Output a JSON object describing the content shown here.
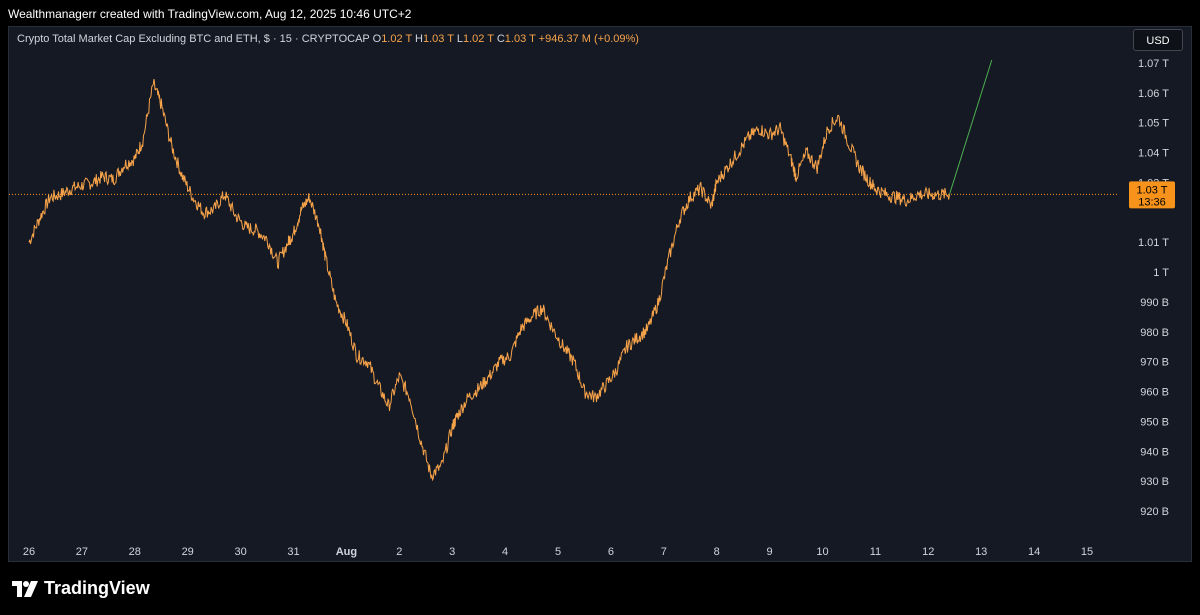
{
  "header": {
    "attribution": "Wealthmanagerr created with TradingView.com, Aug 12, 2025 10:46 UTC+2"
  },
  "legend": {
    "symbol": "Crypto Total Market Cap Excluding BTC and ETH, $ · 15 · CRYPTOCAP",
    "o_label": "O",
    "o_value": "1.02 T",
    "h_label": "H",
    "h_value": "1.03 T",
    "l_label": "L",
    "l_value": "1.02 T",
    "c_label": "C",
    "c_value": "1.03 T",
    "change": "+946.37 M (+0.09%)"
  },
  "currency_button": "USD",
  "price_badge": {
    "price": "1.03 T",
    "countdown": "13:36"
  },
  "footer": {
    "brand": "TradingView"
  },
  "colors": {
    "background": "#151923",
    "series": "#f7a34a",
    "projection": "#4caf50",
    "last_price_line": "#f7931a",
    "badge": "#f7931a"
  },
  "chart_data": {
    "type": "line",
    "title": "Crypto Total Market Cap Excluding BTC and ETH, $ · 15 · CRYPTOCAP",
    "xlabel": "",
    "ylabel": "",
    "y_unit": "USD",
    "ylim": [
      915000000000,
      1075000000000
    ],
    "grid": false,
    "y_ticks": [
      {
        "value": 1070000000000,
        "label": "1.07 T"
      },
      {
        "value": 1060000000000,
        "label": "1.06 T"
      },
      {
        "value": 1050000000000,
        "label": "1.05 T"
      },
      {
        "value": 1040000000000,
        "label": "1.04 T"
      },
      {
        "value": 1030000000000,
        "label": "1.03 T"
      },
      {
        "value": 1010000000000,
        "label": "1.01 T"
      },
      {
        "value": 1000000000000,
        "label": "1 T"
      },
      {
        "value": 990000000000,
        "label": "990 B"
      },
      {
        "value": 980000000000,
        "label": "980 B"
      },
      {
        "value": 970000000000,
        "label": "970 B"
      },
      {
        "value": 960000000000,
        "label": "960 B"
      },
      {
        "value": 950000000000,
        "label": "950 B"
      },
      {
        "value": 940000000000,
        "label": "940 B"
      },
      {
        "value": 930000000000,
        "label": "930 B"
      },
      {
        "value": 920000000000,
        "label": "920 B"
      }
    ],
    "x_ticks": [
      {
        "label": "26",
        "bold": false
      },
      {
        "label": "27",
        "bold": false
      },
      {
        "label": "28",
        "bold": false
      },
      {
        "label": "29",
        "bold": false
      },
      {
        "label": "30",
        "bold": false
      },
      {
        "label": "31",
        "bold": false
      },
      {
        "label": "Aug",
        "bold": true
      },
      {
        "label": "2",
        "bold": false
      },
      {
        "label": "3",
        "bold": false
      },
      {
        "label": "4",
        "bold": false
      },
      {
        "label": "5",
        "bold": false
      },
      {
        "label": "6",
        "bold": false
      },
      {
        "label": "7",
        "bold": false
      },
      {
        "label": "8",
        "bold": false
      },
      {
        "label": "9",
        "bold": false
      },
      {
        "label": "10",
        "bold": false
      },
      {
        "label": "11",
        "bold": false
      },
      {
        "label": "12",
        "bold": false
      },
      {
        "label": "13",
        "bold": false
      },
      {
        "label": "14",
        "bold": false
      },
      {
        "label": "15",
        "bold": false
      }
    ],
    "series": [
      {
        "x_tick_index": [
          0.0,
          0.2,
          0.4,
          0.6,
          0.8,
          1.0,
          1.2,
          1.4,
          1.6,
          1.8,
          2.0,
          2.15,
          2.35,
          2.5,
          2.7,
          2.9,
          3.1,
          3.3,
          3.5,
          3.7,
          3.9,
          4.1,
          4.3,
          4.5,
          4.7,
          4.9,
          5.0,
          5.15,
          5.3,
          5.5,
          5.6,
          5.8,
          6.0,
          6.2,
          6.4,
          6.6,
          6.8,
          7.0,
          7.2,
          7.4,
          7.6,
          7.8,
          8.0,
          8.1,
          8.3,
          8.5,
          8.7,
          8.9,
          9.1,
          9.3,
          9.5,
          9.7,
          9.9,
          10.1,
          10.3,
          10.5,
          10.7,
          10.9,
          11.1,
          11.3,
          11.5,
          11.7,
          11.9,
          12.1,
          12.3,
          12.5,
          12.7,
          12.9,
          13.0,
          13.2,
          13.4,
          13.6,
          13.8,
          14.0,
          14.2,
          14.4,
          14.5,
          14.7,
          14.9,
          15.1,
          15.3,
          15.5,
          15.7,
          15.9,
          16.0,
          16.2,
          16.4,
          16.6,
          16.8,
          17.0,
          17.2,
          17.4
        ],
        "values": [
          1010,
          1018,
          1025,
          1026,
          1028,
          1029,
          1030,
          1032,
          1031,
          1036,
          1038,
          1044,
          1063,
          1056,
          1042,
          1032,
          1025,
          1020,
          1021,
          1026,
          1019,
          1015,
          1014,
          1011,
          1003,
          1010,
          1013,
          1021,
          1025,
          1015,
          1005,
          990,
          983,
          972,
          970,
          962,
          955,
          965,
          958,
          944,
          932,
          935,
          948,
          952,
          958,
          961,
          965,
          970,
          972,
          981,
          985,
          988,
          981,
          975,
          970,
          960,
          958,
          962,
          967,
          975,
          978,
          981,
          990,
          1005,
          1018,
          1025,
          1028,
          1022,
          1030,
          1035,
          1040,
          1045,
          1048,
          1046,
          1048,
          1038,
          1032,
          1040,
          1035,
          1048,
          1052,
          1043,
          1035,
          1030,
          1028,
          1026,
          1025,
          1024,
          1026,
          1026,
          1026,
          1026
        ],
        "value_unit": "B"
      }
    ],
    "projection": {
      "from_x_tick_index": 17.4,
      "from_value": 1026,
      "to_x_tick_index": 18.2,
      "to_value": 1071,
      "value_unit": "B"
    },
    "last_price_value": 1026,
    "last_price_unit": "B"
  }
}
